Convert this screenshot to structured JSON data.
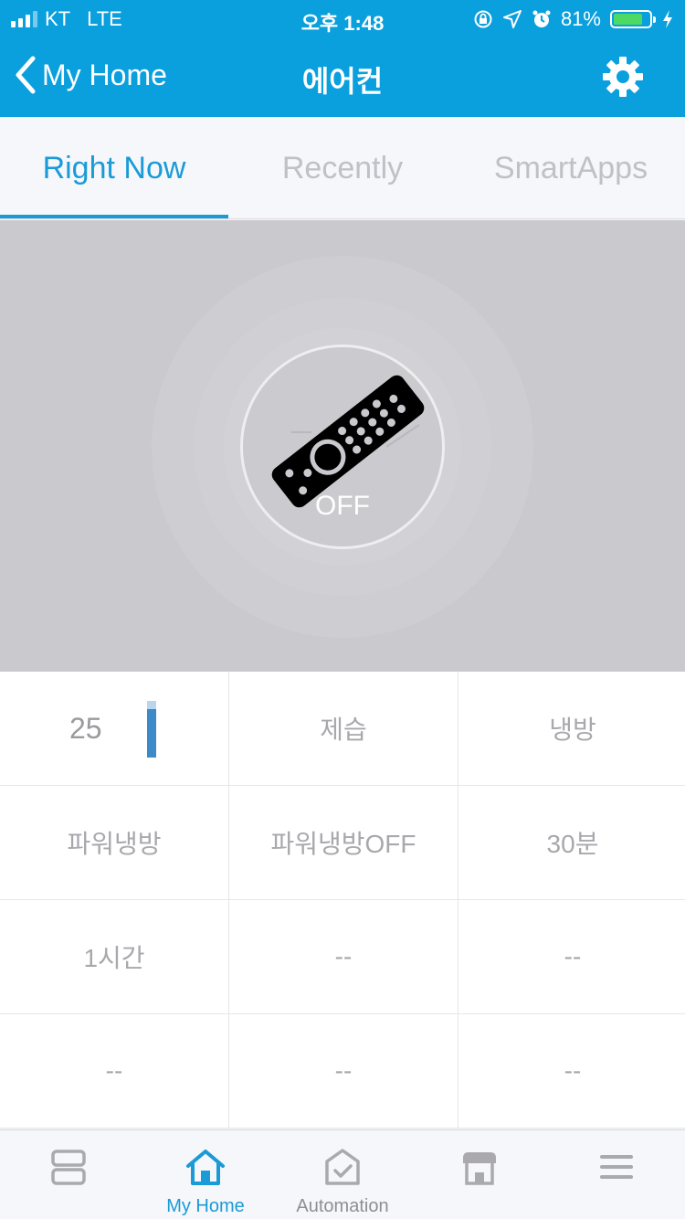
{
  "status_bar": {
    "carrier": "KT",
    "network": "LTE",
    "time": "오후 1:48",
    "battery_percent": "81%",
    "battery_level": 0.81,
    "icons": [
      "signal-icon",
      "orientation-lock-icon",
      "location-icon",
      "alarm-icon",
      "battery-icon",
      "charging-icon"
    ]
  },
  "nav": {
    "back_label": "My Home",
    "title": "에어컨",
    "settings_icon": "gear-icon"
  },
  "tabs": [
    {
      "label": "Right Now",
      "active": true
    },
    {
      "label": "Recently",
      "active": false
    },
    {
      "label": "SmartApps",
      "active": false
    }
  ],
  "hero": {
    "device_icon": "remote-control-icon",
    "state": "OFF"
  },
  "controls": {
    "temperature": {
      "value": "25",
      "level": 0.85
    },
    "cells": [
      "제습",
      "냉방",
      "파워냉방",
      "파워냉방OFF",
      "30분",
      "1시간",
      "--",
      "--",
      "--",
      "--",
      "--"
    ]
  },
  "tabbar": [
    {
      "label": "",
      "icon": "dashboard-icon",
      "active": false
    },
    {
      "label": "My Home",
      "icon": "home-icon",
      "active": true
    },
    {
      "label": "Automation",
      "icon": "automation-icon",
      "active": false
    },
    {
      "label": "",
      "icon": "marketplace-icon",
      "active": false
    },
    {
      "label": "",
      "icon": "menu-icon",
      "active": false
    }
  ],
  "colors": {
    "brand": "#0a9fdd",
    "active_tab": "#1a9bd7",
    "hero_bg": "#c9c9ce"
  }
}
